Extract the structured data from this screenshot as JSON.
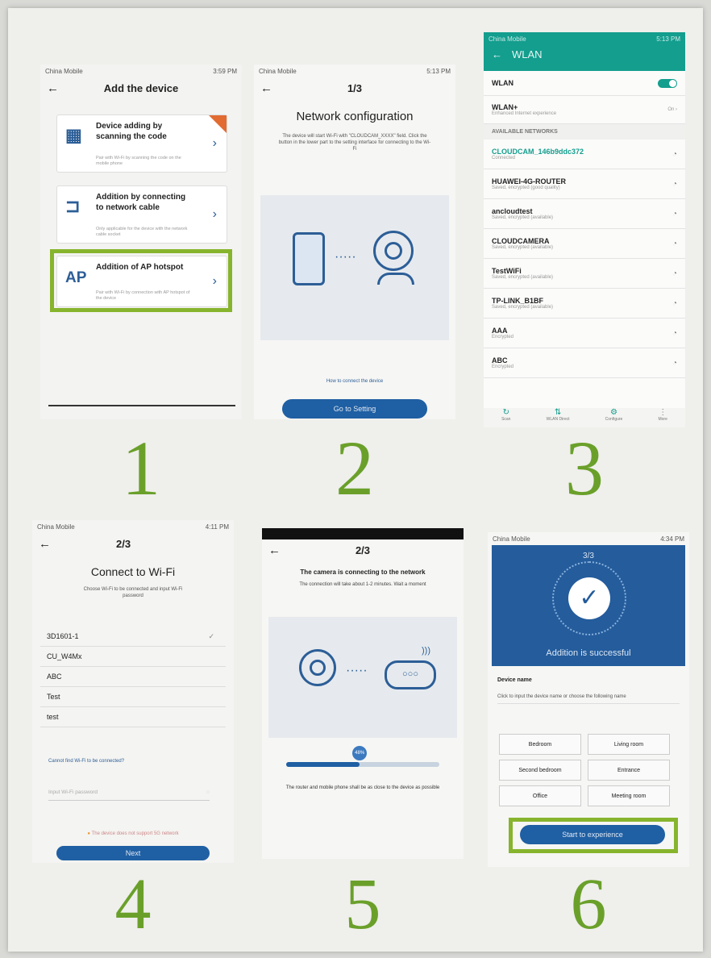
{
  "panel1": {
    "status_left": "China Mobile",
    "status_right": "3:59 PM",
    "title": "Add the device",
    "options": [
      {
        "icon": "qr-code-icon",
        "title": "Device adding by scanning the code",
        "desc": "Pair with Wi-Fi by scanning the code on the mobile phone"
      },
      {
        "icon": "network-cable-icon",
        "title": "Addition by connecting to network cable",
        "desc": "Only applicable for the device with the network cable socket"
      },
      {
        "icon": "ap-icon",
        "icon_text": "AP",
        "title": "Addition of AP hotspot",
        "desc": "Pair with Wi-Fi by connection with AP hotspot of the device"
      }
    ],
    "step": "1"
  },
  "panel2": {
    "status_left": "China Mobile",
    "status_right": "5:13 PM",
    "title": "1/3",
    "heading": "Network configuration",
    "desc": "The device will start Wi-Fi with \"CLOUDCAM_XXXX\" field. Click the button in the lower part to the setting interface for connecting to the Wi-Fi",
    "link": "How to connect the device",
    "button": "Go to Setting",
    "step": "2"
  },
  "panel3": {
    "status_left": "China Mobile",
    "status_right": "5:13 PM",
    "title": "WLAN",
    "wlan_label": "WLAN",
    "wlan_plus": "WLAN+",
    "wlan_plus_desc": "Enhanced Internet experience",
    "wlan_plus_value": "On",
    "section": "AVAILABLE NETWORKS",
    "networks": [
      {
        "name": "CLOUDCAM_146b9ddc372",
        "desc": "Connected"
      },
      {
        "name": "HUAWEI-4G-ROUTER",
        "desc": "Saved, encrypted (good quality)"
      },
      {
        "name": "ancloudtest",
        "desc": "Saved, encrypted (available)"
      },
      {
        "name": "CLOUDCAMERA",
        "desc": "Saved, encrypted (available)"
      },
      {
        "name": "TestWiFi",
        "desc": "Saved, encrypted (available)"
      },
      {
        "name": "TP-LINK_B1BF",
        "desc": "Saved, encrypted (available)"
      },
      {
        "name": "AAA",
        "desc": "Encrypted"
      },
      {
        "name": "ABC",
        "desc": "Encrypted"
      }
    ],
    "bottom": [
      "Scan",
      "WLAN Direct",
      "Configure",
      "More"
    ],
    "step": "3"
  },
  "panel4": {
    "status_left": "China Mobile",
    "status_right": "4:11 PM",
    "title": "2/3",
    "heading": "Connect to Wi-Fi",
    "desc": "Choose Wi-Fi to be connected and input Wi-Fi password",
    "networks": [
      "3D1601-1",
      "CU_W4Mx",
      "ABC",
      "Test",
      "test"
    ],
    "link": "Cannot find Wi-Fi to be connected?",
    "password_placeholder": "Input Wi-Fi password",
    "warning": "The device does not support 5G network",
    "button": "Next",
    "step": "4"
  },
  "panel5": {
    "title": "2/3",
    "heading": "The camera is connecting to the network",
    "desc": "The connection will take about 1-2 minutes. Wait a moment",
    "progress_label": "48%",
    "progress": 0.48,
    "footer": "The router and mobile phone shall be as close to the device as possible",
    "step": "5"
  },
  "panel6": {
    "status_left": "China Mobile",
    "status_right": "4:34 PM",
    "step_label": "3/3",
    "success": "Addition is successful",
    "device_name_label": "Device name",
    "device_name_hint": "Click to input the device name or choose the following name",
    "rooms": [
      "Bedroom",
      "Living room",
      "Second bedroom",
      "Entrance",
      "Office",
      "Meeting room"
    ],
    "button": "Start to experience",
    "step": "6"
  },
  "colors": {
    "accent": "#1f5fa3",
    "highlight": "#87b42d",
    "teal": "#139e8e"
  }
}
